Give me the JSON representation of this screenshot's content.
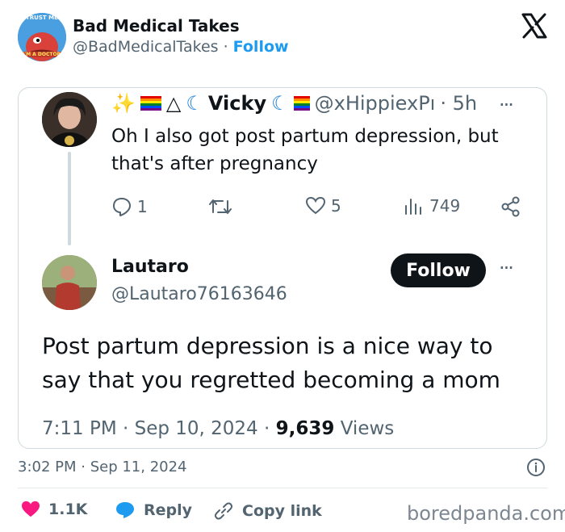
{
  "header": {
    "display_name": "Bad Medical Takes",
    "handle": "@BadMedicalTakes",
    "separator": " · ",
    "follow_label": "Follow"
  },
  "avatar_main": {
    "top_text": "TRUST ME",
    "bottom_text": "I'M A DOCTOR"
  },
  "reply_tweet": {
    "name": "Vicky",
    "handle": "@xHippiexPı",
    "time": "· 5h",
    "more": "···",
    "text": "Oh I also got post partum depression, but that's after pregnancy",
    "replies": "1",
    "likes": "5",
    "views": "749"
  },
  "main_tweet": {
    "name": "Lautaro",
    "handle": "@Lautaro76163646",
    "follow_label": "Follow",
    "more": "···",
    "text": "Post partum depression is a nice way to say that you regretted becoming a mom",
    "timestamp": "7:11 PM · Sep 10, 2024 · ",
    "views_count": "9,639",
    "views_label": " Views"
  },
  "footer": {
    "post_time": "3:02 PM · Sep 11, 2024",
    "likes": "1.1K",
    "reply_label": "Reply",
    "copy_label": "Copy link",
    "brand": "boredpanda.com"
  },
  "colors": {
    "accent": "#1d9bf0",
    "like": "#f91880",
    "text": "#0f1419",
    "muted": "#536471",
    "border": "#cfd9de"
  },
  "icons": [
    "x-logo-icon",
    "reply-icon",
    "retweet-icon",
    "heart-icon",
    "views-icon",
    "share-icon",
    "info-icon",
    "copy-link-icon",
    "speech-bubble-icon"
  ]
}
